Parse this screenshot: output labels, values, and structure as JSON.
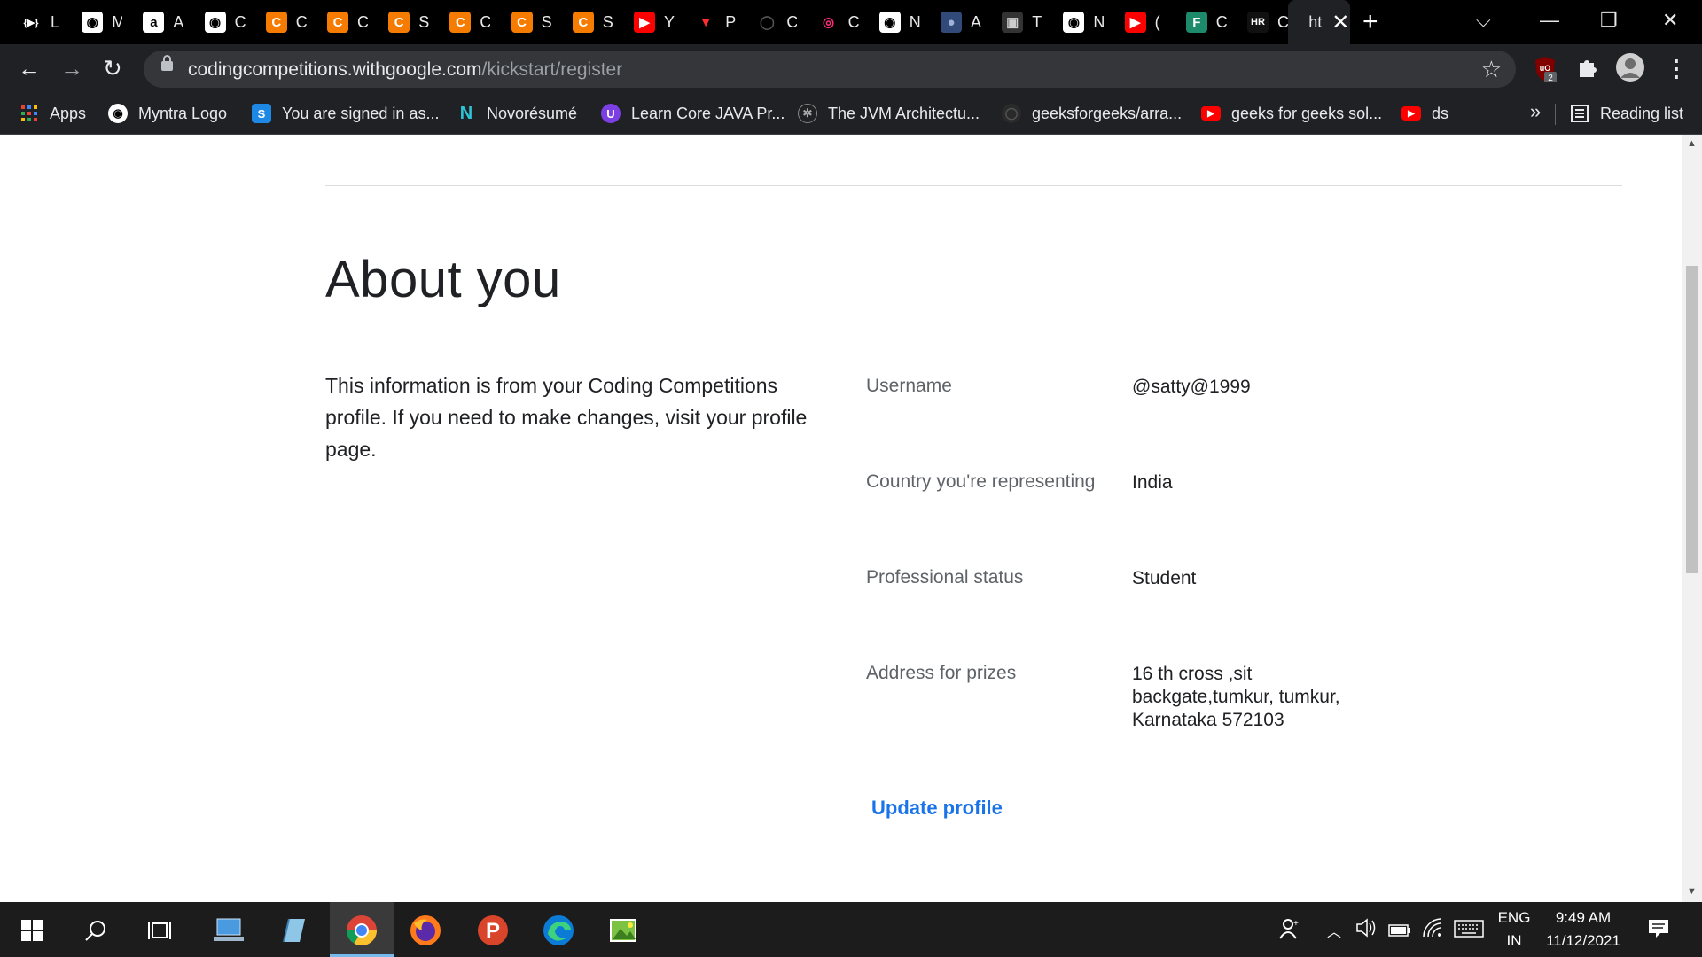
{
  "tabs": [
    {
      "favicon_text": "{▶}",
      "favicon_color": "#ffffff",
      "favicon_bg": "#000000",
      "label": "L"
    },
    {
      "favicon_text": "◉",
      "favicon_color": "#000000",
      "favicon_bg": "#ffffff",
      "label": "M"
    },
    {
      "favicon_text": "a",
      "favicon_color": "#000000",
      "favicon_bg": "#ffffff",
      "label": "A"
    },
    {
      "favicon_text": "◉",
      "favicon_color": "#000000",
      "favicon_bg": "#ffffff",
      "label": "C"
    },
    {
      "favicon_text": "C",
      "favicon_color": "#ffffff",
      "favicon_bg": "#f57c00",
      "label": "C"
    },
    {
      "favicon_text": "C",
      "favicon_color": "#ffffff",
      "favicon_bg": "#f57c00",
      "label": "C"
    },
    {
      "favicon_text": "C",
      "favicon_color": "#ffffff",
      "favicon_bg": "#f57c00",
      "label": "S"
    },
    {
      "favicon_text": "C",
      "favicon_color": "#ffffff",
      "favicon_bg": "#f57c00",
      "label": "C"
    },
    {
      "favicon_text": "C",
      "favicon_color": "#ffffff",
      "favicon_bg": "#f57c00",
      "label": "S"
    },
    {
      "favicon_text": "C",
      "favicon_color": "#ffffff",
      "favicon_bg": "#f57c00",
      "label": "S"
    },
    {
      "favicon_text": "▶",
      "favicon_color": "#ffffff",
      "favicon_bg": "#ff0000",
      "label": "Y"
    },
    {
      "favicon_text": "▼",
      "favicon_color": "#ff2d2d",
      "favicon_bg": "#000000",
      "label": "P"
    },
    {
      "favicon_text": "◯",
      "favicon_color": "#555555",
      "favicon_bg": "#000000",
      "label": "C"
    },
    {
      "favicon_text": "◎",
      "favicon_color": "#ff2d7a",
      "favicon_bg": "#000000",
      "label": "C"
    },
    {
      "favicon_text": "◉",
      "favicon_color": "#000000",
      "favicon_bg": "#ffffff",
      "label": "N"
    },
    {
      "favicon_text": "●",
      "favicon_color": "#9fb3d6",
      "favicon_bg": "#324a7a",
      "label": "A"
    },
    {
      "favicon_text": "▣",
      "favicon_color": "#cccccc",
      "favicon_bg": "#333333",
      "label": "T"
    },
    {
      "favicon_text": "◉",
      "favicon_color": "#000000",
      "favicon_bg": "#ffffff",
      "label": "N"
    },
    {
      "favicon_text": "▶",
      "favicon_color": "#ffffff",
      "favicon_bg": "#ff0000",
      "label": "("
    },
    {
      "favicon_text": "F",
      "favicon_color": "#ffffff",
      "favicon_bg": "#1d8a6b",
      "label": "C"
    },
    {
      "favicon_text": "HR",
      "favicon_color": "#ffffff",
      "favicon_bg": "#111111",
      "label": "C"
    },
    {
      "favicon_text": "",
      "favicon_color": "#ffffff",
      "favicon_bg": "transparent",
      "label": "ht",
      "active": true
    }
  ],
  "toolbar": {
    "url_host": "codingcompetitions.withgoogle.com",
    "url_path": "/kickstart/register",
    "ext_badge": "2"
  },
  "bookmarks": [
    {
      "label": "Apps",
      "icon": "apps-grid-icon"
    },
    {
      "label": "Myntra Logo",
      "icon": "globe-icon"
    },
    {
      "label": "You are signed in as...",
      "icon": "s-icon"
    },
    {
      "label": "Novorésumé",
      "icon": "n-icon"
    },
    {
      "label": "Learn Core JAVA Pr...",
      "icon": "u-icon"
    },
    {
      "label": "The JVM Architectu...",
      "icon": "jvm-icon"
    },
    {
      "label": "geeksforgeeks/arra...",
      "icon": "github-icon"
    },
    {
      "label": "geeks for geeks sol...",
      "icon": "youtube-icon"
    },
    {
      "label": "ds",
      "icon": "youtube-icon"
    }
  ],
  "bookmarks_more": "»",
  "reading_list": "Reading list",
  "page": {
    "heading": "About you",
    "intro": "This information is from your Coding Competitions profile. If you need to make changes, visit your profile page.",
    "fields": [
      {
        "label": "Username",
        "value": "@satty@1999"
      },
      {
        "label": "Country you're representing",
        "value": "India"
      },
      {
        "label": "Professional status",
        "value": "Student"
      },
      {
        "label": "Address for prizes",
        "value": "16 th cross ,sit backgate,tumkur, tumkur, Karnataka 572103"
      }
    ],
    "update_link": "Update profile"
  },
  "taskbar": {
    "language": "ENG",
    "region": "IN",
    "time": "9:49 AM",
    "date": "11/12/2021"
  },
  "colors": {
    "link": "#1a73e8",
    "label": "#5f6368",
    "text": "#202124"
  }
}
